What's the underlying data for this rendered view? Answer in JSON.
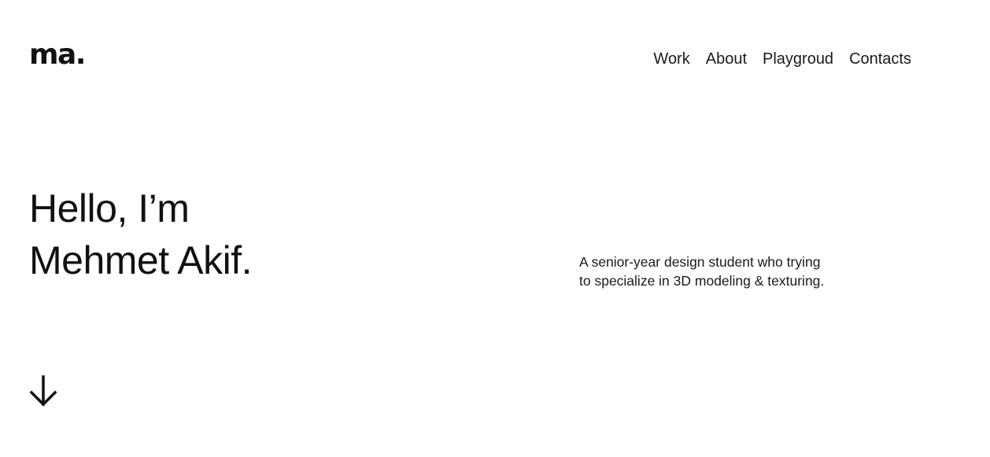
{
  "header": {
    "logo_text": "ma.",
    "nav": [
      {
        "label": "Work"
      },
      {
        "label": "About"
      },
      {
        "label": "Playgroud"
      },
      {
        "label": "Contacts"
      }
    ]
  },
  "hero": {
    "title_line1": "Hello, I’m",
    "title_line2": "Mehmet Akif.",
    "tagline_line1": "A senior-year design student who trying",
    "tagline_line2": "to specialize in 3D modeling & texturing."
  },
  "icons": {
    "scroll_down": "arrow-down-icon"
  },
  "colors": {
    "background": "#ffffff",
    "text": "#1a1a1a"
  }
}
